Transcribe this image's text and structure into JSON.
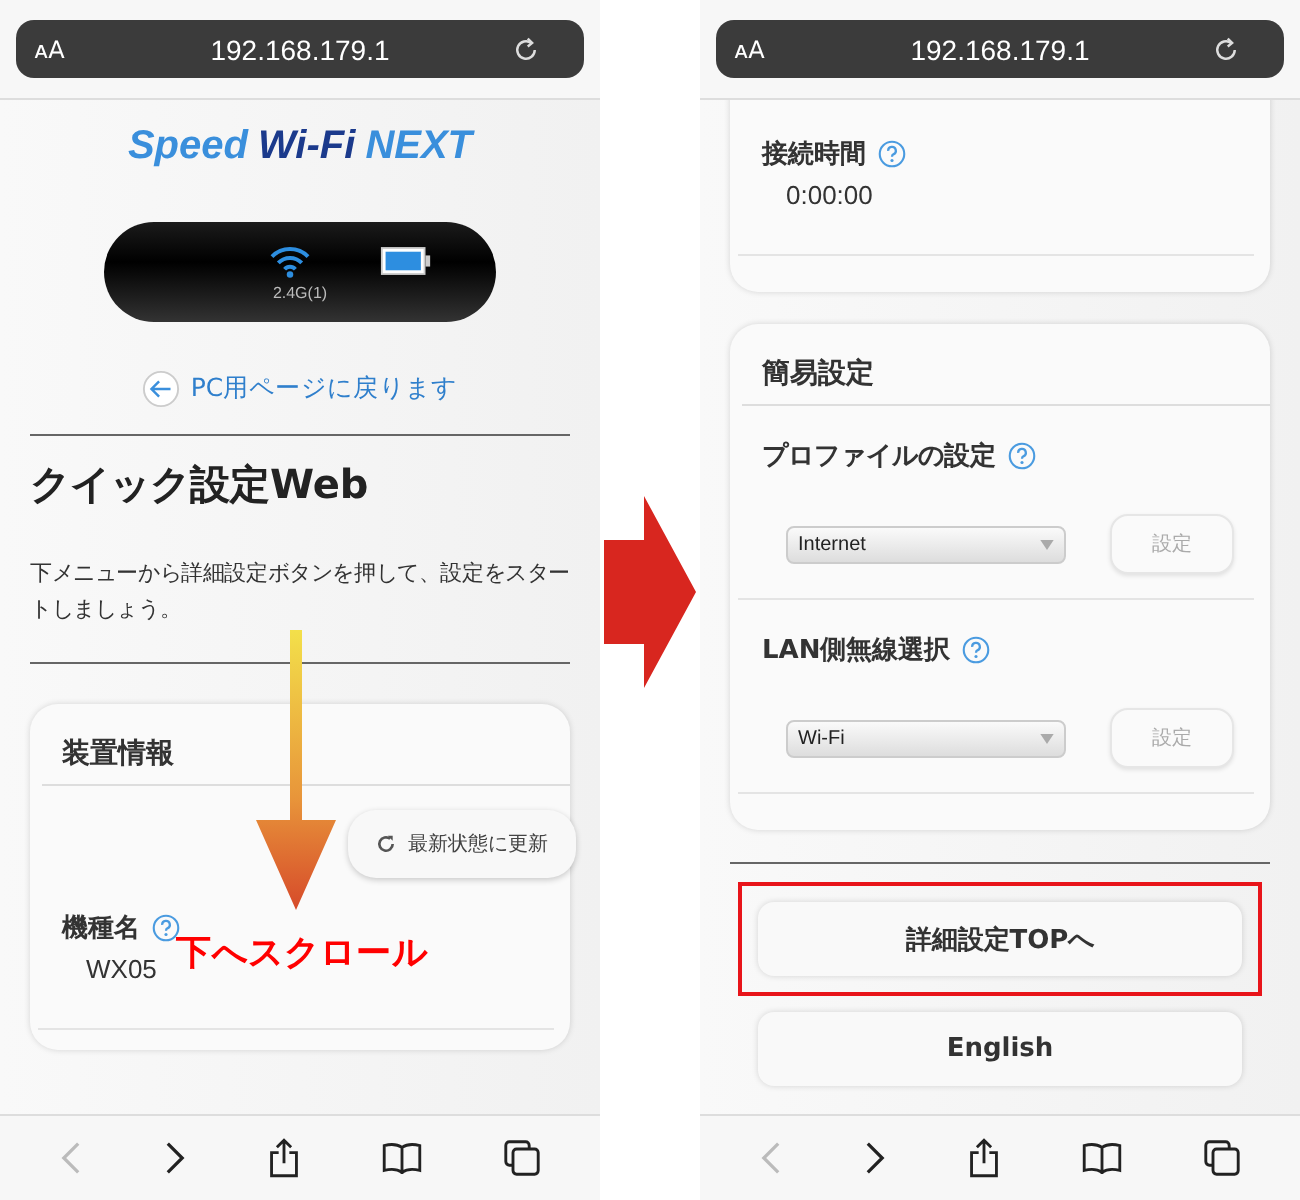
{
  "left_screen": {
    "address_bar": {
      "text_size": "ᴀA",
      "url": "192.168.179.1"
    },
    "logo": [
      {
        "text": "Speed",
        "kind": "light"
      },
      {
        "text": "Wi-Fi",
        "kind": "dark"
      },
      {
        "text": "NEXT",
        "kind": "light"
      }
    ],
    "device_band": "2.4G(1)",
    "back_link": "PC用ページに戻ります",
    "title": "クイック設定Web",
    "intro": "下メニューから詳細設定ボタンを押して、設定をスタートしましょう。",
    "card": {
      "heading": "装置情報",
      "refresh_button": "最新状態に更新",
      "fields": [
        {
          "label": "機種名",
          "value": "WX05"
        }
      ]
    },
    "toolbar": {
      "back_enabled": false,
      "forward_enabled": true
    }
  },
  "annotation": {
    "scroll_label": "下へスクロール"
  },
  "right_screen": {
    "address_bar": {
      "text_size": "ᴀA",
      "url": "192.168.179.1"
    },
    "status_fields": [
      {
        "label": "接続時間",
        "value": "0:00:00"
      }
    ],
    "settings_card": {
      "heading": "簡易設定",
      "rows": [
        {
          "label": "プロファイルの設定",
          "select": "Internet",
          "button": "設定",
          "disabled": true
        },
        {
          "label": "LAN側無線選択",
          "select": "Wi-Fi",
          "button": "設定",
          "disabled": true
        }
      ]
    },
    "buttons": [
      {
        "label": "詳細設定TOPへ",
        "highlighted": true
      },
      {
        "label": "English",
        "highlighted": false
      }
    ],
    "toolbar": {
      "back_enabled": false,
      "forward_enabled": true
    }
  }
}
